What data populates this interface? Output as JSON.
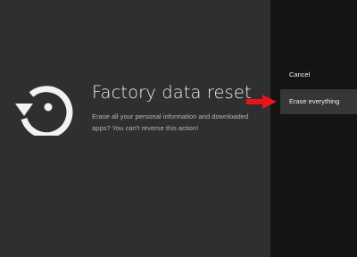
{
  "dialog": {
    "title": "Factory data reset",
    "description": "Erase all your personal information and downloaded apps? You can't reverse this action!",
    "icon": "factory-reset-icon"
  },
  "options": {
    "cancel_label": "Cancel",
    "erase_label": "Erase everything"
  },
  "annotation": {
    "icon": "red-arrow-icon",
    "color": "#e8141a"
  },
  "colors": {
    "main_background": "#2f2f2f",
    "side_background": "#141414",
    "selected_option": "#363636"
  }
}
